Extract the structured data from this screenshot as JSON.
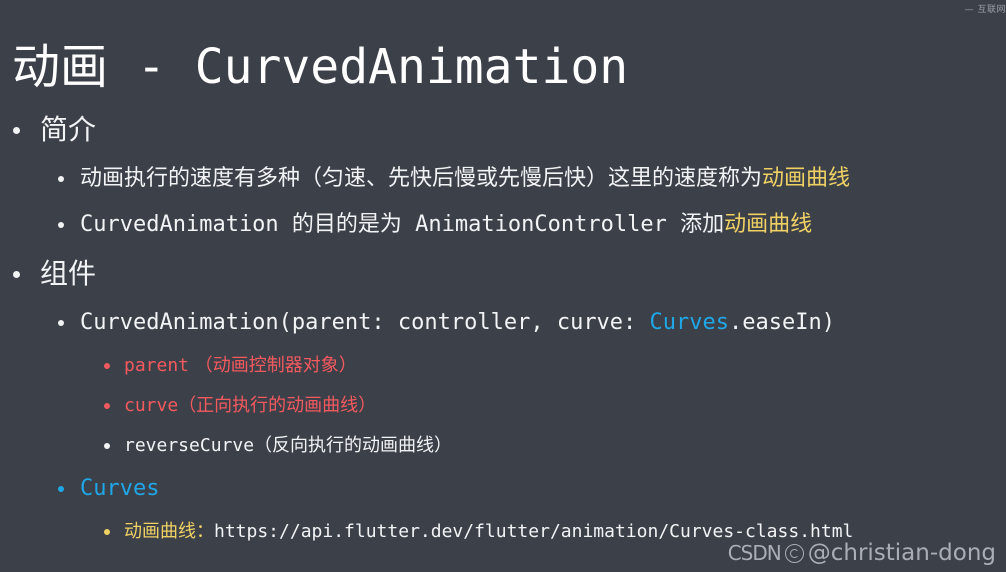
{
  "slide": {
    "corner_note": "— 互联网",
    "title": "动画 - CurvedAnimation",
    "background_color": "#3c4049",
    "colors": {
      "text": "#f2f3f5",
      "yellow": "#f0d264",
      "red": "#f4595e",
      "blue": "#1fa7e8"
    }
  },
  "outline": {
    "section1": {
      "heading": "简介",
      "item1": {
        "text_plain": "动画执行的速度有多种（匀速、先快后慢或先慢后快）这里的速度称为",
        "text_highlight": "动画曲线"
      },
      "item2": {
        "part1": "CurvedAnimation 的目的是为 AnimationController 添加",
        "part2": "动画曲线"
      }
    },
    "section2": {
      "heading": "组件",
      "signature": {
        "before": "CurvedAnimation(parent: controller, curve: ",
        "class_name": "Curves",
        "after": ".easeIn)"
      },
      "params": [
        {
          "name": "parent",
          "desc": " （动画控制器对象）",
          "color": "red"
        },
        {
          "name": "curve",
          "desc": "（正向执行的动画曲线）",
          "color": "red"
        },
        {
          "name": "reverseCurve",
          "desc": "（反向执行的动画曲线）",
          "color": "white"
        }
      ],
      "curves_heading": "Curves",
      "curves_link": {
        "label": "动画曲线：",
        "url": "https://api.flutter.dev/flutter/animation/Curves-class.html"
      }
    }
  },
  "watermark": {
    "mark": "CSDN",
    "handle": "@christian-dong"
  }
}
